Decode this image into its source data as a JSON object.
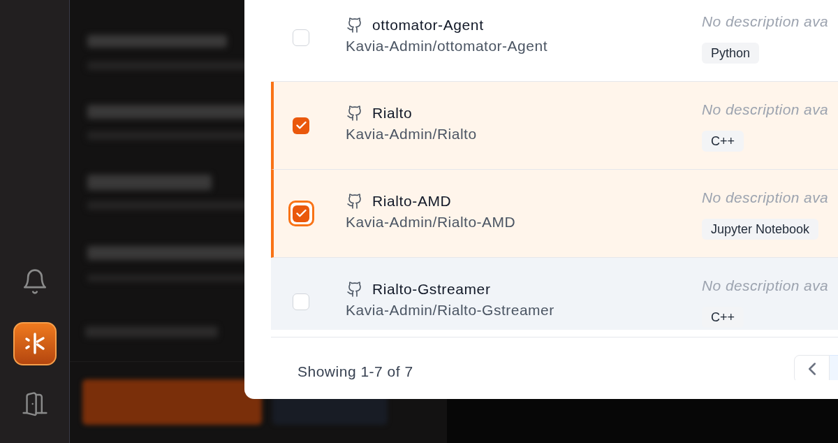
{
  "repository_list": {
    "rows": [
      {
        "name": "ottomator-Agent",
        "path": "Kavia-Admin/ottomator-Agent",
        "description": "No description ava",
        "language": "Python",
        "checked": false,
        "focused": false,
        "hovered": false
      },
      {
        "name": "Rialto",
        "path": "Kavia-Admin/Rialto",
        "description": "No description ava",
        "language": "C++",
        "checked": true,
        "focused": false,
        "hovered": false
      },
      {
        "name": "Rialto-AMD",
        "path": "Kavia-Admin/Rialto-AMD",
        "description": "No description ava",
        "language": "Jupyter Notebook",
        "checked": true,
        "focused": true,
        "hovered": false
      },
      {
        "name": "Rialto-Gstreamer",
        "path": "Kavia-Admin/Rialto-Gstreamer",
        "description": "No description ava",
        "language": "C++",
        "checked": false,
        "focused": false,
        "hovered": true
      }
    ]
  },
  "footer": {
    "summary": "Showing 1-7 of 7"
  }
}
